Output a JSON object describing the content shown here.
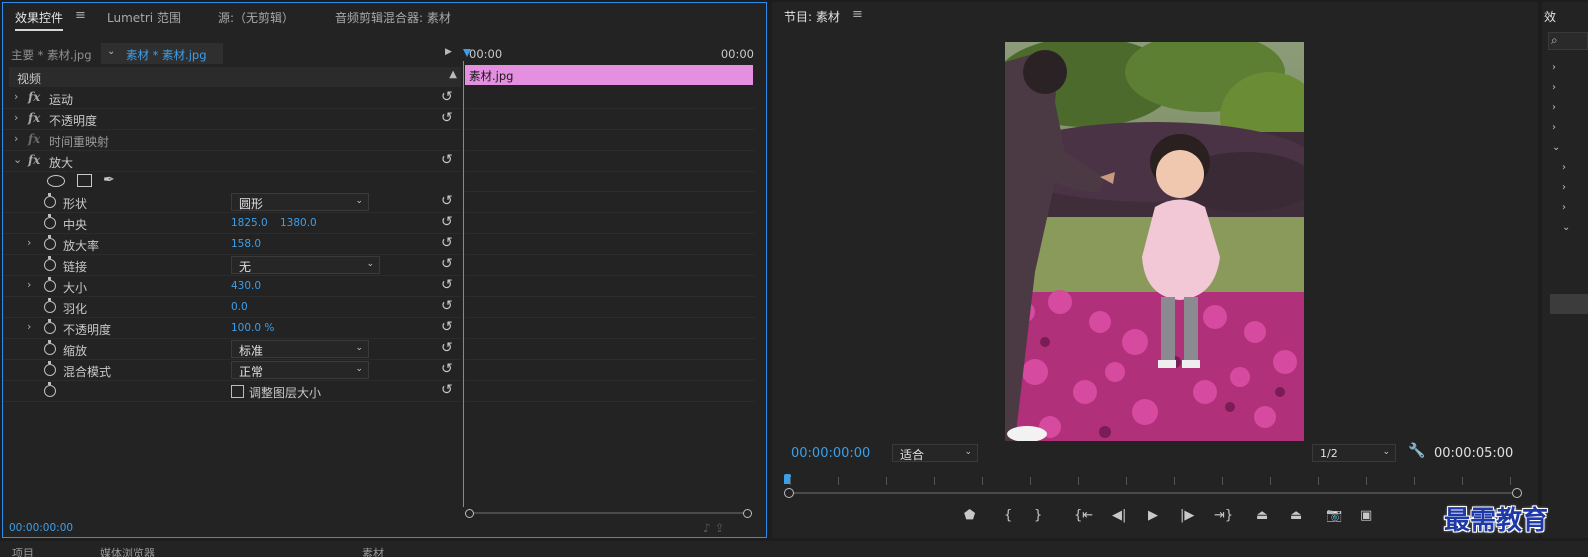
{
  "effect_controls": {
    "tabs": [
      {
        "label": "效果控件",
        "active": true
      },
      {
        "label": "Lumetri 范围"
      },
      {
        "label": "源:（无剪辑）"
      },
      {
        "label": "音频剪辑混合器: 素材"
      }
    ],
    "menu_glyph": "≡",
    "master_clip": "主要 * 素材.jpg",
    "sequence_clip": "素材 * 素材.jpg",
    "section": "视频",
    "effects": [
      {
        "label": "运动",
        "expanded": false,
        "dim": false
      },
      {
        "label": "不透明度",
        "expanded": false,
        "dim": false
      },
      {
        "label": "时间重映射",
        "expanded": false,
        "dim": true
      },
      {
        "label": "放大",
        "expanded": true,
        "dim": false
      }
    ],
    "magnify_properties": {
      "shape": {
        "label": "形状",
        "value": "圆形"
      },
      "center": {
        "label": "中央",
        "x": "1825.0",
        "y": "1380.0"
      },
      "magnification": {
        "label": "放大率",
        "value": "158.0"
      },
      "link": {
        "label": "链接",
        "value": "无"
      },
      "size": {
        "label": "大小",
        "value": "430.0"
      },
      "feather": {
        "label": "羽化",
        "value": "0.0"
      },
      "opacity": {
        "label": "不透明度",
        "value": "100.0 %"
      },
      "scaling": {
        "label": "缩放",
        "value": "标准"
      },
      "blend_mode": {
        "label": "混合模式",
        "value": "正常"
      },
      "resize_layer": {
        "label": "调整图层大小",
        "checked": false
      }
    },
    "timeline": {
      "start": "00:00",
      "end": "00:00",
      "clip_name": "素材.jpg"
    },
    "current_time": "00:00:00:00"
  },
  "program_monitor": {
    "title": "节目: 素材",
    "menu_glyph": "≡",
    "current_time": "00:00:00:00",
    "fit": "适合",
    "resolution": "1/2",
    "duration": "00:00:05:00",
    "controls": [
      "marker",
      "in",
      "out",
      "go-to-in",
      "step-back",
      "play",
      "step-forward",
      "go-to-out",
      "lift",
      "extract",
      "export-frame",
      "compare"
    ]
  },
  "effects_panel": {
    "title": "效"
  },
  "bottom_strip": {
    "tab1": "项目",
    "tab2": "媒体浏览器",
    "tab3": "素材"
  },
  "watermark": "最需教育",
  "colors": {
    "accent_blue": "#3d9ee8",
    "clip_pink": "#e58fe0",
    "panel_bg": "#232323",
    "focus_border": "#2d8ceb"
  }
}
